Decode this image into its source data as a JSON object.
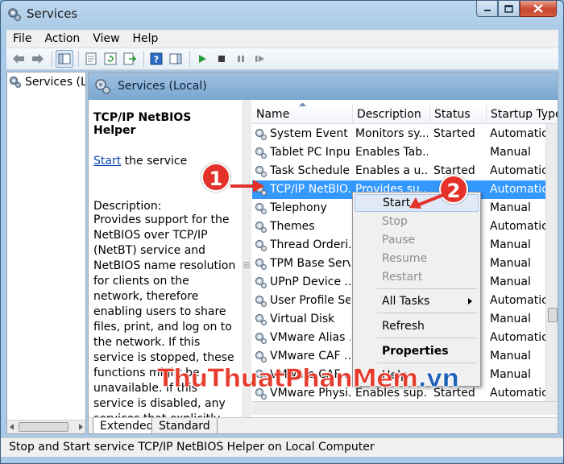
{
  "window": {
    "title": "Services"
  },
  "menubar": {
    "items": [
      "File",
      "Action",
      "View",
      "Help"
    ]
  },
  "tree": {
    "item_label": "Services (Local)"
  },
  "main_header": {
    "label": "Services (Local)"
  },
  "details": {
    "title": "TCP/IP NetBIOS Helper",
    "start_link": "Start",
    "start_suffix": " the service",
    "description_label": "Description:",
    "description_text": "Provides support for the NetBIOS over TCP/IP (NetBT) service and NetBIOS name resolution for clients on the network, therefore enabling users to share files, print, and log on to the network. If this service is stopped, these functions might be unavailable. If this service is disabled, any services that explicitly depend on it will fail to start."
  },
  "columns": [
    "Name",
    "Description",
    "Status",
    "Startup Type"
  ],
  "services": [
    {
      "name": "System Event ...",
      "description": "Monitors sy...",
      "status": "Started",
      "startup": "Automatic"
    },
    {
      "name": "Tablet PC Inpu...",
      "description": "Enables Tab...",
      "status": "",
      "startup": "Manual"
    },
    {
      "name": "Task Scheduler",
      "description": "Enables a u...",
      "status": "Started",
      "startup": "Automatic"
    },
    {
      "name": "TCP/IP NetBIO...",
      "description": "Provides su...",
      "status": "",
      "startup": "Automatic"
    },
    {
      "name": "Telephony",
      "description": "",
      "status": "",
      "startup": "Manual"
    },
    {
      "name": "Themes",
      "description": "",
      "status": "",
      "startup": "Automatic"
    },
    {
      "name": "Thread Orderi...",
      "description": "",
      "status": "",
      "startup": "Manual"
    },
    {
      "name": "TPM Base Serv...",
      "description": "",
      "status": "",
      "startup": "Manual"
    },
    {
      "name": "UPnP Device ...",
      "description": "",
      "status": "",
      "startup": "Manual"
    },
    {
      "name": "User Profile Se...",
      "description": "",
      "status": "",
      "startup": "Automatic"
    },
    {
      "name": "Virtual Disk",
      "description": "",
      "status": "",
      "startup": "Manual"
    },
    {
      "name": "VMware Alias ...",
      "description": "",
      "status": "",
      "startup": "Automatic"
    },
    {
      "name": "VMware CAF ...",
      "description": "",
      "status": "",
      "startup": "Manual"
    },
    {
      "name": "VMware CAF ...",
      "description": "",
      "status": "",
      "startup": "Manual"
    },
    {
      "name": "VMware Physi...",
      "description": "Enables sup...",
      "status": "Started",
      "startup": "Automatic"
    }
  ],
  "context_menu": {
    "start": "Start",
    "stop": "Stop",
    "pause": "Pause",
    "resume": "Resume",
    "restart": "Restart",
    "all_tasks": "All Tasks",
    "refresh": "Refresh",
    "properties": "Properties",
    "help": "Help"
  },
  "tabs": {
    "extended": "Extended",
    "standard": "Standard"
  },
  "statusbar": {
    "text": "Stop and Start service TCP/IP NetBIOS Helper on Local Computer"
  },
  "annotations": {
    "badge1": "1",
    "badge2": "2"
  },
  "watermark": {
    "part1": "ThuThuat",
    "part2": "PhanMem",
    "part3": ".vn"
  },
  "colors": {
    "selection": "#3399ff",
    "badge": "#e4322b",
    "link": "#0645ad"
  }
}
